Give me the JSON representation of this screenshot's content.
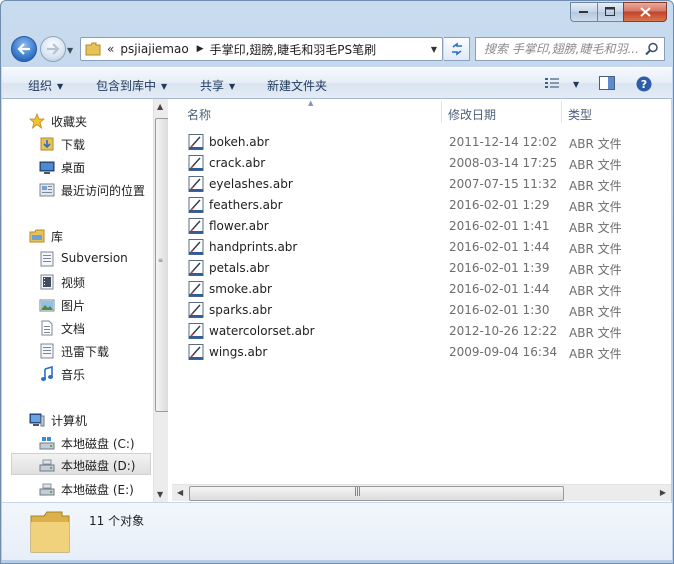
{
  "window": {
    "caption_buttons": [
      "minimize",
      "maximize",
      "close"
    ]
  },
  "address_bar": {
    "overflow_chevron": "«",
    "breadcrumbs": [
      "psjiajiemao",
      "手掌印,翅膀,睫毛和羽毛PS笔刷"
    ]
  },
  "search": {
    "placeholder": "搜索 手掌印,翅膀,睫毛和羽..."
  },
  "toolbar": {
    "organize": "组织",
    "include_in_library": "包含到库中",
    "share": "共享",
    "new_folder": "新建文件夹"
  },
  "nav": {
    "favorites": {
      "label": "收藏夹",
      "items": [
        "下载",
        "桌面",
        "最近访问的位置"
      ]
    },
    "libraries": {
      "label": "库",
      "items": [
        "Subversion",
        "视频",
        "图片",
        "文档",
        "迅雷下载",
        "音乐"
      ]
    },
    "computer": {
      "label": "计算机",
      "items": [
        "本地磁盘 (C:)",
        "本地磁盘 (D:)",
        "本地磁盘 (E:)"
      ],
      "selected_index": 1
    }
  },
  "columns": {
    "name": "名称",
    "date_modified": "修改日期",
    "type": "类型"
  },
  "files": [
    {
      "name": "bokeh.abr",
      "date": "2011-12-14 12:02",
      "type": "ABR 文件"
    },
    {
      "name": "crack.abr",
      "date": "2008-03-14 17:25",
      "type": "ABR 文件"
    },
    {
      "name": "eyelashes.abr",
      "date": "2007-07-15 11:32",
      "type": "ABR 文件"
    },
    {
      "name": "feathers.abr",
      "date": "2016-02-01 1:29",
      "type": "ABR 文件"
    },
    {
      "name": "flower.abr",
      "date": "2016-02-01 1:41",
      "type": "ABR 文件"
    },
    {
      "name": "handprints.abr",
      "date": "2016-02-01 1:44",
      "type": "ABR 文件"
    },
    {
      "name": "petals.abr",
      "date": "2016-02-01 1:39",
      "type": "ABR 文件"
    },
    {
      "name": "smoke.abr",
      "date": "2016-02-01 1:44",
      "type": "ABR 文件"
    },
    {
      "name": "sparks.abr",
      "date": "2016-02-01 1:30",
      "type": "ABR 文件"
    },
    {
      "name": "watercolorset.abr",
      "date": "2012-10-26 12:22",
      "type": "ABR 文件"
    },
    {
      "name": "wings.abr",
      "date": "2009-09-04 16:34",
      "type": "ABR 文件"
    }
  ],
  "details": {
    "item_count": "11 个对象"
  }
}
